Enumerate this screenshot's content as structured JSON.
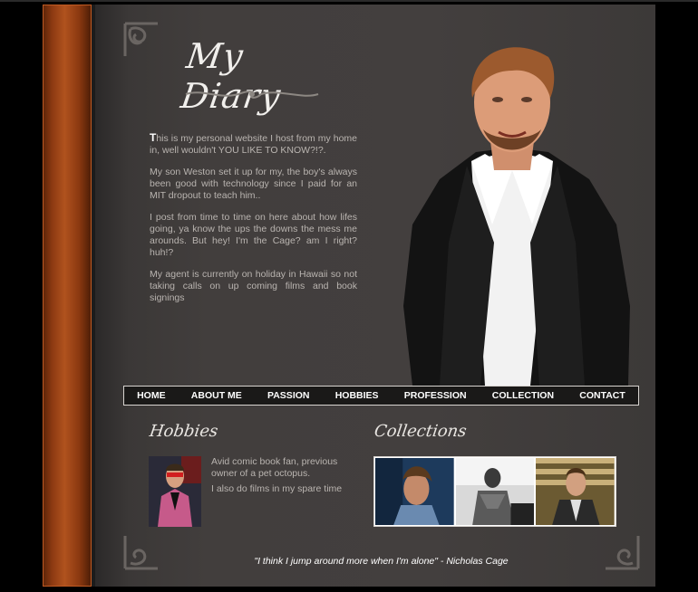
{
  "site": {
    "title": "My Diary"
  },
  "intro": {
    "paragraphs": [
      "This is my personal website I host from my home in, well wouldn't YOU LIKE TO KNOW?!?.",
      "My son Weston set it up for my, the boy's always been good with technology since I paid for an MIT dropout to teach him..",
      "I post from time to time on here about how lifes going, ya know the ups the downs the mess me arounds. But hey! I'm the Cage? am I right? huh!?",
      "My agent is currently on holiday in Hawaii so not taking calls on up coming films and book signings"
    ]
  },
  "nav": {
    "items": [
      "HOME",
      "ABOUT ME",
      "PASSION",
      "HOBBIES",
      "PROFESSION",
      "COLLECTION",
      "CONTACT"
    ]
  },
  "hobbies": {
    "heading": "Hobbies",
    "lines": [
      "Avid comic book fan, previous owner of a pet octopus.",
      "I also do films in my spare time"
    ]
  },
  "collections": {
    "heading": "Collections"
  },
  "footer": {
    "quote": "\"I think I jump around more when I'm alone\" - Nicholas Cage"
  },
  "colors": {
    "spine": "#8d3a12",
    "page": "#423e3d",
    "nav_bg": "#1a1918",
    "text": "#b9b4b0"
  }
}
